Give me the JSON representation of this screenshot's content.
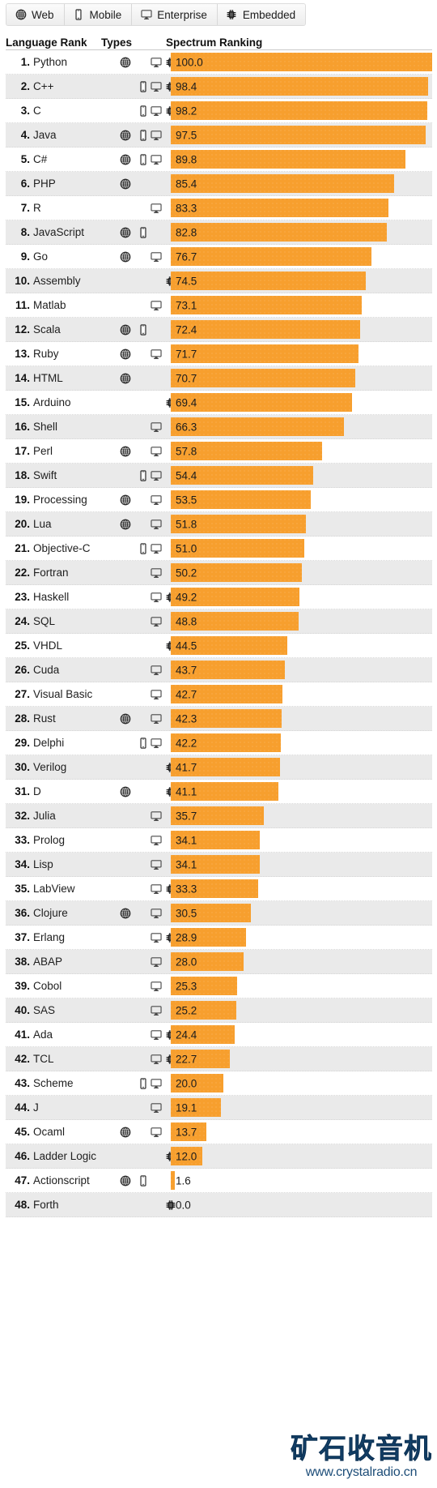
{
  "tabs": [
    {
      "label": "Web",
      "icon": "globe-icon"
    },
    {
      "label": "Mobile",
      "icon": "phone-icon"
    },
    {
      "label": "Enterprise",
      "icon": "monitor-icon"
    },
    {
      "label": "Embedded",
      "icon": "chip-icon"
    }
  ],
  "columns": {
    "language_rank": "Language Rank",
    "types": "Types",
    "spectrum_ranking": "Spectrum Ranking"
  },
  "colors": {
    "bar": "#f79f2e",
    "row_even": "#eaeaea",
    "row_odd": "#ffffff",
    "watermark": "#15456f"
  },
  "watermark": {
    "title": "矿石收音机",
    "url": "www.crystalradio.cn"
  },
  "chart_data": {
    "type": "bar",
    "title": "Spectrum Ranking",
    "xlabel": "",
    "ylabel": "Language Rank",
    "xlim": [
      0,
      100
    ],
    "grid": false,
    "legend": [
      "Web",
      "Mobile",
      "Enterprise",
      "Embedded"
    ],
    "legend_position": "top",
    "categories": [
      "Python",
      "C++",
      "C",
      "Java",
      "C#",
      "PHP",
      "R",
      "JavaScript",
      "Go",
      "Assembly",
      "Matlab",
      "Scala",
      "Ruby",
      "HTML",
      "Arduino",
      "Shell",
      "Perl",
      "Swift",
      "Processing",
      "Lua",
      "Objective-C",
      "Fortran",
      "Haskell",
      "SQL",
      "VHDL",
      "Cuda",
      "Visual Basic",
      "Rust",
      "Delphi",
      "Verilog",
      "D",
      "Julia",
      "Prolog",
      "Lisp",
      "LabView",
      "Clojure",
      "Erlang",
      "ABAP",
      "Cobol",
      "SAS",
      "Ada",
      "TCL",
      "Scheme",
      "J",
      "Ocaml",
      "Ladder Logic",
      "Actionscript",
      "Forth"
    ],
    "values": [
      100.0,
      98.4,
      98.2,
      97.5,
      89.8,
      85.4,
      83.3,
      82.8,
      76.7,
      74.5,
      73.1,
      72.4,
      71.7,
      70.7,
      69.4,
      66.3,
      57.8,
      54.4,
      53.5,
      51.8,
      51.0,
      50.2,
      49.2,
      48.8,
      44.5,
      43.7,
      42.7,
      42.3,
      42.2,
      41.7,
      41.1,
      35.7,
      34.1,
      34.1,
      33.3,
      30.5,
      28.9,
      28.0,
      25.3,
      25.2,
      24.4,
      22.7,
      20.0,
      19.1,
      13.7,
      12.0,
      1.6,
      0.0
    ]
  },
  "rows": [
    {
      "rank": "1.",
      "name": "Python",
      "value": "100.0",
      "pct": 100.0,
      "web": true,
      "mobile": false,
      "enterprise": true,
      "embedded": true
    },
    {
      "rank": "2.",
      "name": "C++",
      "value": "98.4",
      "pct": 98.4,
      "web": false,
      "mobile": true,
      "enterprise": true,
      "embedded": true
    },
    {
      "rank": "3.",
      "name": "C",
      "value": "98.2",
      "pct": 98.2,
      "web": false,
      "mobile": true,
      "enterprise": true,
      "embedded": true
    },
    {
      "rank": "4.",
      "name": "Java",
      "value": "97.5",
      "pct": 97.5,
      "web": true,
      "mobile": true,
      "enterprise": true,
      "embedded": false
    },
    {
      "rank": "5.",
      "name": "C#",
      "value": "89.8",
      "pct": 89.8,
      "web": true,
      "mobile": true,
      "enterprise": true,
      "embedded": false
    },
    {
      "rank": "6.",
      "name": "PHP",
      "value": "85.4",
      "pct": 85.4,
      "web": true,
      "mobile": false,
      "enterprise": false,
      "embedded": false
    },
    {
      "rank": "7.",
      "name": "R",
      "value": "83.3",
      "pct": 83.3,
      "web": false,
      "mobile": false,
      "enterprise": true,
      "embedded": false
    },
    {
      "rank": "8.",
      "name": "JavaScript",
      "value": "82.8",
      "pct": 82.8,
      "web": true,
      "mobile": true,
      "enterprise": false,
      "embedded": false
    },
    {
      "rank": "9.",
      "name": "Go",
      "value": "76.7",
      "pct": 76.7,
      "web": true,
      "mobile": false,
      "enterprise": true,
      "embedded": false
    },
    {
      "rank": "10.",
      "name": "Assembly",
      "value": "74.5",
      "pct": 74.5,
      "web": false,
      "mobile": false,
      "enterprise": false,
      "embedded": true
    },
    {
      "rank": "11.",
      "name": "Matlab",
      "value": "73.1",
      "pct": 73.1,
      "web": false,
      "mobile": false,
      "enterprise": true,
      "embedded": false
    },
    {
      "rank": "12.",
      "name": "Scala",
      "value": "72.4",
      "pct": 72.4,
      "web": true,
      "mobile": true,
      "enterprise": false,
      "embedded": false
    },
    {
      "rank": "13.",
      "name": "Ruby",
      "value": "71.7",
      "pct": 71.7,
      "web": true,
      "mobile": false,
      "enterprise": true,
      "embedded": false
    },
    {
      "rank": "14.",
      "name": "HTML",
      "value": "70.7",
      "pct": 70.7,
      "web": true,
      "mobile": false,
      "enterprise": false,
      "embedded": false
    },
    {
      "rank": "15.",
      "name": "Arduino",
      "value": "69.4",
      "pct": 69.4,
      "web": false,
      "mobile": false,
      "enterprise": false,
      "embedded": true
    },
    {
      "rank": "16.",
      "name": "Shell",
      "value": "66.3",
      "pct": 66.3,
      "web": false,
      "mobile": false,
      "enterprise": true,
      "embedded": false
    },
    {
      "rank": "17.",
      "name": "Perl",
      "value": "57.8",
      "pct": 57.8,
      "web": true,
      "mobile": false,
      "enterprise": true,
      "embedded": false
    },
    {
      "rank": "18.",
      "name": "Swift",
      "value": "54.4",
      "pct": 54.4,
      "web": false,
      "mobile": true,
      "enterprise": true,
      "embedded": false
    },
    {
      "rank": "19.",
      "name": "Processing",
      "value": "53.5",
      "pct": 53.5,
      "web": true,
      "mobile": false,
      "enterprise": true,
      "embedded": false
    },
    {
      "rank": "20.",
      "name": "Lua",
      "value": "51.8",
      "pct": 51.8,
      "web": true,
      "mobile": false,
      "enterprise": true,
      "embedded": false
    },
    {
      "rank": "21.",
      "name": "Objective-C",
      "value": "51.0",
      "pct": 51.0,
      "web": false,
      "mobile": true,
      "enterprise": true,
      "embedded": false
    },
    {
      "rank": "22.",
      "name": "Fortran",
      "value": "50.2",
      "pct": 50.2,
      "web": false,
      "mobile": false,
      "enterprise": true,
      "embedded": false
    },
    {
      "rank": "23.",
      "name": "Haskell",
      "value": "49.2",
      "pct": 49.2,
      "web": false,
      "mobile": false,
      "enterprise": true,
      "embedded": true
    },
    {
      "rank": "24.",
      "name": "SQL",
      "value": "48.8",
      "pct": 48.8,
      "web": false,
      "mobile": false,
      "enterprise": true,
      "embedded": false
    },
    {
      "rank": "25.",
      "name": "VHDL",
      "value": "44.5",
      "pct": 44.5,
      "web": false,
      "mobile": false,
      "enterprise": false,
      "embedded": true
    },
    {
      "rank": "26.",
      "name": "Cuda",
      "value": "43.7",
      "pct": 43.7,
      "web": false,
      "mobile": false,
      "enterprise": true,
      "embedded": false
    },
    {
      "rank": "27.",
      "name": "Visual Basic",
      "value": "42.7",
      "pct": 42.7,
      "web": false,
      "mobile": false,
      "enterprise": true,
      "embedded": false
    },
    {
      "rank": "28.",
      "name": "Rust",
      "value": "42.3",
      "pct": 42.3,
      "web": true,
      "mobile": false,
      "enterprise": true,
      "embedded": false
    },
    {
      "rank": "29.",
      "name": "Delphi",
      "value": "42.2",
      "pct": 42.2,
      "web": false,
      "mobile": true,
      "enterprise": true,
      "embedded": false
    },
    {
      "rank": "30.",
      "name": "Verilog",
      "value": "41.7",
      "pct": 41.7,
      "web": false,
      "mobile": false,
      "enterprise": false,
      "embedded": true
    },
    {
      "rank": "31.",
      "name": "D",
      "value": "41.1",
      "pct": 41.1,
      "web": true,
      "mobile": false,
      "enterprise": false,
      "embedded": true
    },
    {
      "rank": "32.",
      "name": "Julia",
      "value": "35.7",
      "pct": 35.7,
      "web": false,
      "mobile": false,
      "enterprise": true,
      "embedded": false
    },
    {
      "rank": "33.",
      "name": "Prolog",
      "value": "34.1",
      "pct": 34.1,
      "web": false,
      "mobile": false,
      "enterprise": true,
      "embedded": false
    },
    {
      "rank": "34.",
      "name": "Lisp",
      "value": "34.1",
      "pct": 34.1,
      "web": false,
      "mobile": false,
      "enterprise": true,
      "embedded": false
    },
    {
      "rank": "35.",
      "name": "LabView",
      "value": "33.3",
      "pct": 33.3,
      "web": false,
      "mobile": false,
      "enterprise": true,
      "embedded": true
    },
    {
      "rank": "36.",
      "name": "Clojure",
      "value": "30.5",
      "pct": 30.5,
      "web": true,
      "mobile": false,
      "enterprise": true,
      "embedded": false
    },
    {
      "rank": "37.",
      "name": "Erlang",
      "value": "28.9",
      "pct": 28.9,
      "web": false,
      "mobile": false,
      "enterprise": true,
      "embedded": true
    },
    {
      "rank": "38.",
      "name": "ABAP",
      "value": "28.0",
      "pct": 28.0,
      "web": false,
      "mobile": false,
      "enterprise": true,
      "embedded": false
    },
    {
      "rank": "39.",
      "name": "Cobol",
      "value": "25.3",
      "pct": 25.3,
      "web": false,
      "mobile": false,
      "enterprise": true,
      "embedded": false
    },
    {
      "rank": "40.",
      "name": "SAS",
      "value": "25.2",
      "pct": 25.2,
      "web": false,
      "mobile": false,
      "enterprise": true,
      "embedded": false
    },
    {
      "rank": "41.",
      "name": "Ada",
      "value": "24.4",
      "pct": 24.4,
      "web": false,
      "mobile": false,
      "enterprise": true,
      "embedded": true
    },
    {
      "rank": "42.",
      "name": "TCL",
      "value": "22.7",
      "pct": 22.7,
      "web": false,
      "mobile": false,
      "enterprise": true,
      "embedded": true
    },
    {
      "rank": "43.",
      "name": "Scheme",
      "value": "20.0",
      "pct": 20.0,
      "web": false,
      "mobile": true,
      "enterprise": true,
      "embedded": false
    },
    {
      "rank": "44.",
      "name": "J",
      "value": "19.1",
      "pct": 19.1,
      "web": false,
      "mobile": false,
      "enterprise": true,
      "embedded": false
    },
    {
      "rank": "45.",
      "name": "Ocaml",
      "value": "13.7",
      "pct": 13.7,
      "web": true,
      "mobile": false,
      "enterprise": true,
      "embedded": false
    },
    {
      "rank": "46.",
      "name": "Ladder Logic",
      "value": "12.0",
      "pct": 12.0,
      "web": false,
      "mobile": false,
      "enterprise": false,
      "embedded": true
    },
    {
      "rank": "47.",
      "name": "Actionscript",
      "value": "1.6",
      "pct": 1.6,
      "web": true,
      "mobile": true,
      "enterprise": false,
      "embedded": false
    },
    {
      "rank": "48.",
      "name": "Forth",
      "value": "0.0",
      "pct": 0.0,
      "web": false,
      "mobile": false,
      "enterprise": false,
      "embedded": true
    }
  ]
}
